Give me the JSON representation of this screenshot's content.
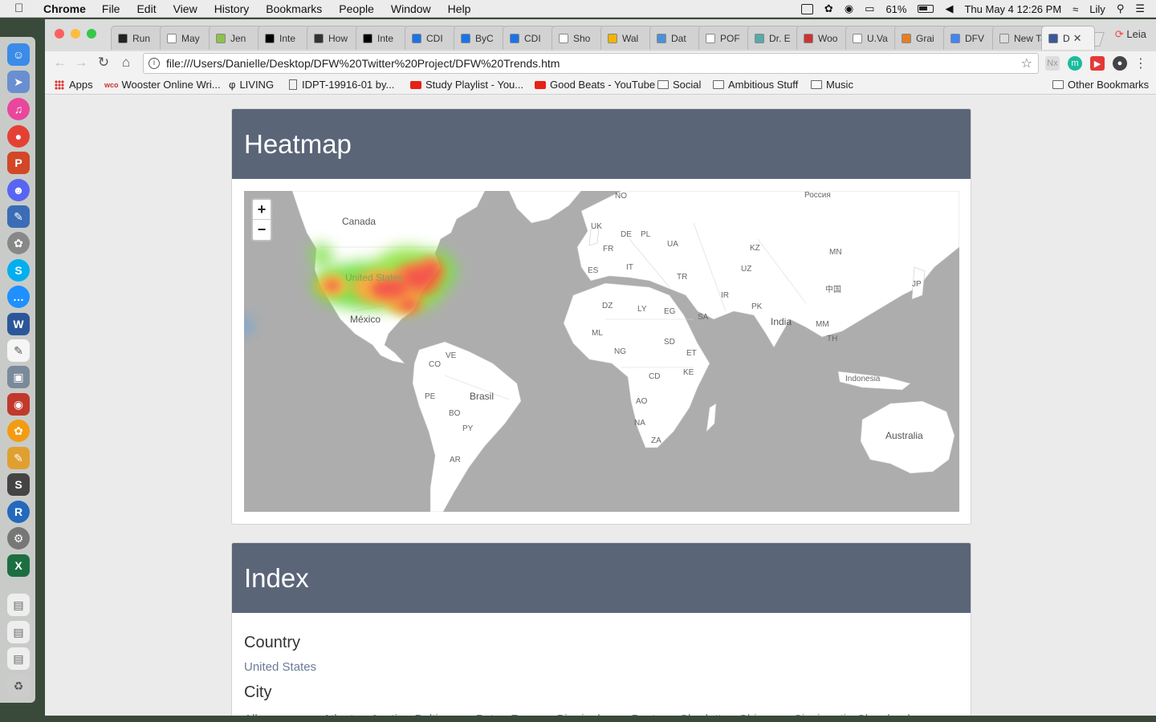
{
  "menubar": {
    "app_name": "Chrome",
    "menus": [
      "File",
      "Edit",
      "View",
      "History",
      "Bookmarks",
      "People",
      "Window",
      "Help"
    ],
    "battery": "61%",
    "clock": "Thu May 4  12:26 PM",
    "user": "Lily"
  },
  "tabs": [
    {
      "title": "Run",
      "fav": "#222"
    },
    {
      "title": "May",
      "fav": "#fff"
    },
    {
      "title": "Jen",
      "fav": "#8bc34a"
    },
    {
      "title": "Inte",
      "fav": "#000"
    },
    {
      "title": "How",
      "fav": "#333"
    },
    {
      "title": "Inte",
      "fav": "#000"
    },
    {
      "title": "CDI",
      "fav": "#1a73e8"
    },
    {
      "title": "ByC",
      "fav": "#1a73e8"
    },
    {
      "title": "CDI",
      "fav": "#1a73e8"
    },
    {
      "title": "Sho",
      "fav": "#fff"
    },
    {
      "title": "Wal",
      "fav": "#f4b400"
    },
    {
      "title": "Dat",
      "fav": "#4a90d9"
    },
    {
      "title": "POF",
      "fav": "#fff"
    },
    {
      "title": "Dr. E",
      "fav": "#5aa"
    },
    {
      "title": "Woo",
      "fav": "#c33"
    },
    {
      "title": "U.Va",
      "fav": "#fff"
    },
    {
      "title": "Grai",
      "fav": "#e67e22"
    },
    {
      "title": "DFV",
      "fav": "#4285f4"
    },
    {
      "title": "New Ta",
      "fav": "#ddd"
    },
    {
      "title": "D",
      "fav": "#3b5998"
    }
  ],
  "profile_name": "Leia",
  "address_bar": {
    "url": "file:///Users/Danielle/Desktop/DFW%20Twitter%20Project/DFW%20Trends.htm"
  },
  "bookmarks": {
    "apps": "Apps",
    "items": [
      "Wooster Online Wri...",
      "LIVING",
      "IDPT-19916-01 by...",
      "Study Playlist - You...",
      "Good Beats - YouTube",
      "Social",
      "Ambitious Stuff",
      "Music"
    ],
    "other": "Other Bookmarks"
  },
  "heatmap_panel": {
    "title": "Heatmap",
    "zoom_in": "+",
    "zoom_out": "−",
    "map_labels": {
      "canada": "Canada",
      "united_states": "United States",
      "mexico": "México",
      "brasil": "Brasil",
      "india": "India",
      "australia": "Australia",
      "indonesia": "Indonesia",
      "russia": "Россия",
      "china": "中国",
      "no": "NO",
      "uk": "UK",
      "de": "DE",
      "pl": "PL",
      "fr": "FR",
      "ua": "UA",
      "es": "ES",
      "it": "IT",
      "tr": "TR",
      "kz": "KZ",
      "mn": "MN",
      "uz": "UZ",
      "ir": "IR",
      "pk": "PK",
      "sa": "SA",
      "eg": "EG",
      "ly": "LY",
      "dz": "DZ",
      "ml": "ML",
      "ng": "NG",
      "sd": "SD",
      "et": "ET",
      "cd": "CD",
      "ke": "KE",
      "ao": "AO",
      "na": "NA",
      "za": "ZA",
      "ve": "VE",
      "co": "CO",
      "pe": "PE",
      "bo": "BO",
      "py": "PY",
      "ar": "AR",
      "mm": "MM",
      "th": "TH",
      "jp": "JP"
    }
  },
  "index_panel": {
    "title": "Index",
    "country_heading": "Country",
    "country": "United States",
    "city_heading": "City",
    "cities": [
      "Albuquerque",
      "Atlanta",
      "Austin",
      "Baltimore",
      "Baton Rouge",
      "Birmingham",
      "Boston",
      "Charlotte",
      "Chicago",
      "Cincinnati",
      "Cleveland"
    ]
  }
}
